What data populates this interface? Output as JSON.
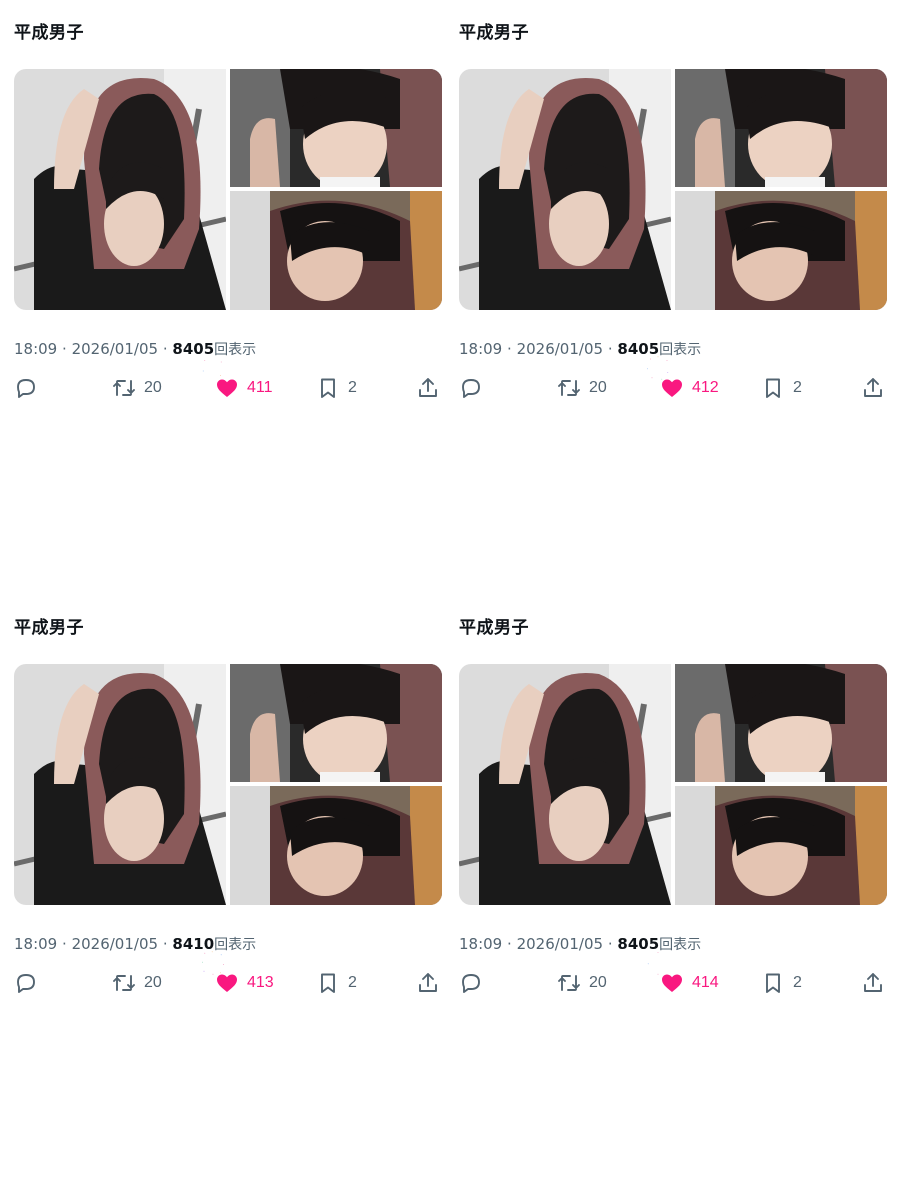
{
  "colors": {
    "like_pink": "#f91880",
    "muted_text": "#536471",
    "primary_text": "#0f1419"
  },
  "tweets": [
    {
      "author": "平成男子",
      "time": "18:09",
      "separator": "·",
      "date": "2026/01/05",
      "views": "8405",
      "views_label": "回表示",
      "retweets": "20",
      "likes": "411",
      "bookmarks": "2",
      "liked": true
    },
    {
      "author": "平成男子",
      "time": "18:09",
      "separator": "·",
      "date": "2026/01/05",
      "views": "8405",
      "views_label": "回表示",
      "retweets": "20",
      "likes": "412",
      "bookmarks": "2",
      "liked": true
    },
    {
      "author": "平成男子",
      "time": "18:09",
      "separator": "·",
      "date": "2026/01/05",
      "views": "8410",
      "views_label": "回表示",
      "retweets": "20",
      "likes": "413",
      "bookmarks": "2",
      "liked": true
    },
    {
      "author": "平成男子",
      "time": "18:09",
      "separator": "·",
      "date": "2026/01/05",
      "views": "8405",
      "views_label": "回表示",
      "retweets": "20",
      "likes": "414",
      "bookmarks": "2",
      "liked": true
    }
  ],
  "icons": {
    "reply": "reply-icon",
    "retweet": "retweet-icon",
    "like": "heart-icon",
    "bookmark": "bookmark-icon",
    "share": "share-icon"
  }
}
